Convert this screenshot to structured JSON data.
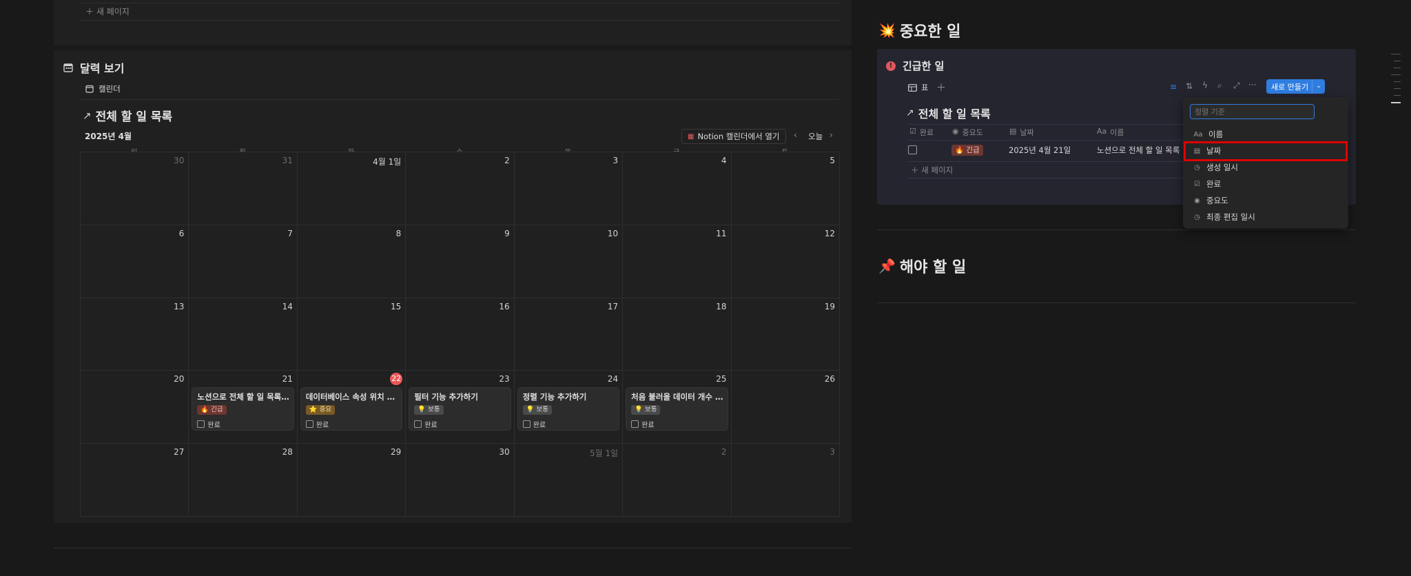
{
  "left": {
    "top_new_page": "새 페이지",
    "calendar_section_title": "달력 보기",
    "calendar_tab": "캘린더",
    "db_title": "전체 할 일 목록",
    "month_label": "2025년 4월",
    "open_in_notion": "Notion 캘린더에서 열기",
    "today": "오늘",
    "weekdays": [
      "일",
      "월",
      "화",
      "수",
      "목",
      "금",
      "토"
    ],
    "weeks": [
      [
        "30",
        "31",
        "4월 1일",
        "2",
        "3",
        "4",
        "5"
      ],
      [
        "6",
        "7",
        "8",
        "9",
        "10",
        "11",
        "12"
      ],
      [
        "13",
        "14",
        "15",
        "16",
        "17",
        "18",
        "19"
      ],
      [
        "20",
        "21",
        "22",
        "23",
        "24",
        "25",
        "26"
      ],
      [
        "27",
        "28",
        "29",
        "30",
        "5월 1일",
        "2",
        "3"
      ]
    ],
    "events": [
      {
        "title": "노션으로 전체 할 일 목록 만...",
        "tag": "🔥 긴급",
        "check": "완료"
      },
      {
        "title": "데이터베이스 속성 위치 변...",
        "tag": "⭐ 중요",
        "check": "완료"
      },
      {
        "title": "필터 기능 추가하기",
        "tag": "💡 보통",
        "check": "완료"
      },
      {
        "title": "정렬 기능 추가하기",
        "tag": "💡 보통",
        "check": "완료"
      },
      {
        "title": "처음 불러올 데이터 개수 지...",
        "tag": "💡 보통",
        "check": "완료"
      }
    ]
  },
  "right": {
    "important_heading": "중요한 일",
    "important_emoji": "💥",
    "urgent_title": "긴급한 일",
    "view_tab": "표",
    "new_button": "새로 만들기",
    "db_title": "전체 할 일 목록",
    "columns": [
      "완료",
      "중요도",
      "날짜",
      "이름"
    ],
    "row": {
      "tag": "🔥 긴급",
      "date": "2025년 4월 21일",
      "name": "노션으로 전체 할 일 목록 만"
    },
    "new_page": "새 페이지",
    "todo_heading": "해야 할 일",
    "todo_emoji": "📌"
  },
  "sort_menu": {
    "placeholder": "정렬 기준",
    "items": [
      "이름",
      "날짜",
      "생성 일시",
      "완료",
      "중요도",
      "최종 편집 일시"
    ]
  },
  "colors": {
    "accent": "#2f7de0",
    "highlight": "#e00000",
    "today": "#eb5757"
  }
}
